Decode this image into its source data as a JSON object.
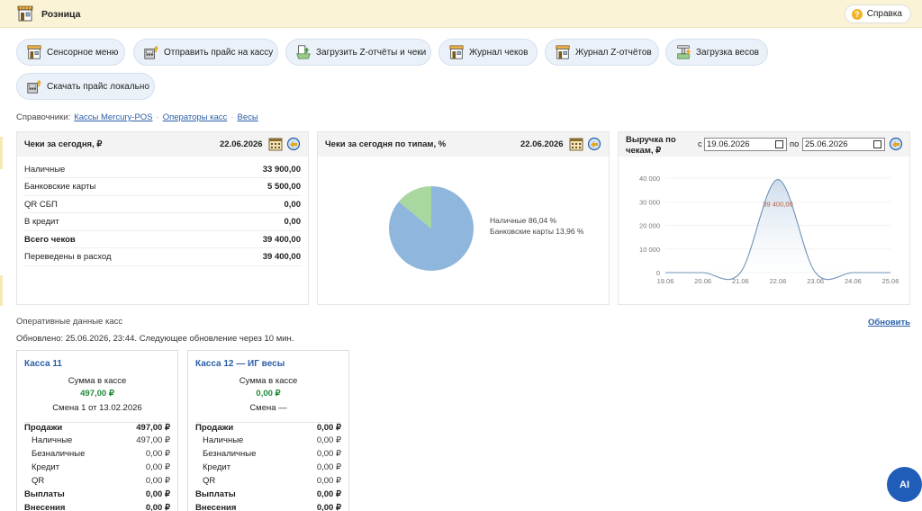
{
  "app": {
    "title": "Розница",
    "help_label": "Справка"
  },
  "toolbar": [
    {
      "label": "Сенсорное меню",
      "icon": "shop-icon"
    },
    {
      "label": "Отправить прайс на кассу",
      "icon": "send-price-icon"
    },
    {
      "label": "Загрузить Z-отчёты и чеки",
      "icon": "upload-icon"
    },
    {
      "label": "Журнал чеков",
      "icon": "shop-icon"
    },
    {
      "label": "Журнал Z-отчётов",
      "icon": "shop-icon"
    },
    {
      "label": "Загрузка весов",
      "icon": "scale-icon"
    },
    {
      "label": "Скачать прайс локально",
      "icon": "download-price-icon"
    }
  ],
  "references": {
    "label": "Справочники:",
    "links": [
      "Кассы Mercury-POS",
      "Операторы касс",
      "Весы"
    ],
    "separator": "·"
  },
  "receipts_today": {
    "title": "Чеки за сегодня, ₽",
    "date": "22.06.2026",
    "rows": [
      {
        "label": "Наличные",
        "value": "33 900,00",
        "bold": false
      },
      {
        "label": "Банковские карты",
        "value": "5 500,00",
        "bold": false
      },
      {
        "label": "QR СБП",
        "value": "0,00",
        "bold": false
      },
      {
        "label": "В кредит",
        "value": "0,00",
        "bold": false
      },
      {
        "label": "Всего чеков",
        "value": "39 400,00",
        "bold": true
      },
      {
        "label": "Переведены в расход",
        "value": "39 400,00",
        "bold": false
      }
    ]
  },
  "receipts_by_type": {
    "title": "Чеки за сегодня по типам, %",
    "date": "22.06.2026",
    "legend": [
      "Наличные 86,04 %",
      "Банковские карты 13,96 %"
    ]
  },
  "revenue": {
    "title_line1": "Выручка по",
    "title_line2": "чекам, ₽",
    "from_label": "с",
    "to_label": "по",
    "from_value": "19.06.2026",
    "to_value": "25.06.2026",
    "peak_label": "39 400,00"
  },
  "chart_data": [
    {
      "type": "pie",
      "labels": [
        "Наличные",
        "Банковские карты"
      ],
      "values": [
        86.04,
        13.96
      ],
      "colors": [
        "#8fb6dc",
        "#a8d8a0"
      ]
    },
    {
      "type": "area",
      "categories": [
        "19.06",
        "20.06",
        "21.06",
        "22.06",
        "23.06",
        "24.06",
        "25.06"
      ],
      "values": [
        0,
        0,
        0,
        39400,
        0,
        0,
        0
      ],
      "yticks": [
        "0",
        "10 000",
        "20 000",
        "30 000",
        "40 000"
      ],
      "ylim": [
        0,
        40000
      ],
      "line_color": "#6e93b8"
    }
  ],
  "operational": {
    "title": "Оперативные данные касс",
    "updated": "Обновлено: 25.06.2026, 23:44. Следующее обновление через 10 мин.",
    "refresh_label": "Обновить"
  },
  "registers": [
    {
      "title": "Касса 11",
      "cash_label": "Сумма в кассе",
      "cash_value": "497,00 ₽",
      "shift": "Смена 1 от 13.02.2026",
      "rows": [
        {
          "label": "Продажи",
          "value": "497,00 ₽",
          "kind": "main"
        },
        {
          "label": "Наличные",
          "value": "497,00 ₽",
          "kind": "sub"
        },
        {
          "label": "Безналичные",
          "value": "0,00 ₽",
          "kind": "sub"
        },
        {
          "label": "Кредит",
          "value": "0,00 ₽",
          "kind": "sub"
        },
        {
          "label": "QR",
          "value": "0,00 ₽",
          "kind": "sub"
        },
        {
          "label": "Выплаты",
          "value": "0,00 ₽",
          "kind": "main"
        },
        {
          "label": "Внесения",
          "value": "0,00 ₽",
          "kind": "main"
        }
      ]
    },
    {
      "title": "Касса 12 — ИГ весы",
      "cash_label": "Сумма в кассе",
      "cash_value": "0,00 ₽",
      "shift": "Смена —",
      "rows": [
        {
          "label": "Продажи",
          "value": "0,00 ₽",
          "kind": "main"
        },
        {
          "label": "Наличные",
          "value": "0,00 ₽",
          "kind": "sub"
        },
        {
          "label": "Безналичные",
          "value": "0,00 ₽",
          "kind": "sub"
        },
        {
          "label": "Кредит",
          "value": "0,00 ₽",
          "kind": "sub"
        },
        {
          "label": "QR",
          "value": "0,00 ₽",
          "kind": "sub"
        },
        {
          "label": "Выплаты",
          "value": "0,00 ₽",
          "kind": "main"
        },
        {
          "label": "Внесения",
          "value": "0,00 ₽",
          "kind": "main"
        }
      ]
    }
  ],
  "ai_button": {
    "label": "AI"
  }
}
